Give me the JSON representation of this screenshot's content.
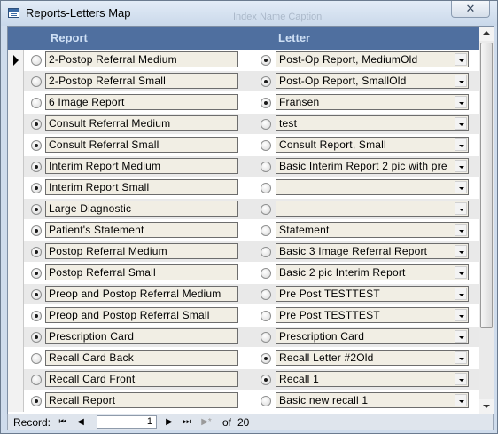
{
  "window": {
    "title": "Reports-Letters Map",
    "ghost_title": "Index Name Caption",
    "close_label": "✕"
  },
  "columns": {
    "report": "Report",
    "letter": "Letter"
  },
  "rows": [
    {
      "report": "2-Postop Referral Medium",
      "report_selected": false,
      "letter": "Post-Op Report, MediumOld",
      "letter_selected": true,
      "current": true
    },
    {
      "report": "2-Postop Referral Small",
      "report_selected": false,
      "letter": "Post-Op Report, SmallOld",
      "letter_selected": true,
      "current": false
    },
    {
      "report": "6 Image Report",
      "report_selected": false,
      "letter": "Fransen",
      "letter_selected": true,
      "current": false
    },
    {
      "report": "Consult Referral Medium",
      "report_selected": true,
      "letter": "test",
      "letter_selected": false,
      "current": false
    },
    {
      "report": "Consult Referral Small",
      "report_selected": true,
      "letter": "Consult Report, Small",
      "letter_selected": false,
      "current": false
    },
    {
      "report": "Interim Report Medium",
      "report_selected": true,
      "letter": "Basic Interim Report 2 pic with pre",
      "letter_selected": false,
      "current": false
    },
    {
      "report": "Interim Report Small",
      "report_selected": true,
      "letter": "",
      "letter_selected": false,
      "current": false
    },
    {
      "report": "Large Diagnostic",
      "report_selected": true,
      "letter": "",
      "letter_selected": false,
      "current": false
    },
    {
      "report": "Patient's Statement",
      "report_selected": true,
      "letter": "Statement",
      "letter_selected": false,
      "current": false
    },
    {
      "report": "Postop Referral Medium",
      "report_selected": true,
      "letter": "Basic 3 Image Referral Report",
      "letter_selected": false,
      "current": false
    },
    {
      "report": "Postop Referral Small",
      "report_selected": true,
      "letter": "Basic 2 pic Interim Report",
      "letter_selected": false,
      "current": false
    },
    {
      "report": "Preop and Postop Referral Medium",
      "report_selected": true,
      "letter": "Pre Post TESTTEST",
      "letter_selected": false,
      "current": false
    },
    {
      "report": "Preop and Postop Referral Small",
      "report_selected": true,
      "letter": "Pre Post TESTTEST",
      "letter_selected": false,
      "current": false
    },
    {
      "report": "Prescription Card",
      "report_selected": true,
      "letter": "Prescription Card",
      "letter_selected": false,
      "current": false
    },
    {
      "report": "Recall Card Back",
      "report_selected": false,
      "letter": "Recall Letter #2Old",
      "letter_selected": true,
      "current": false
    },
    {
      "report": "Recall Card Front",
      "report_selected": false,
      "letter": "Recall 1",
      "letter_selected": true,
      "current": false
    },
    {
      "report": "Recall Report",
      "report_selected": true,
      "letter": "Basic new recall 1",
      "letter_selected": false,
      "current": false
    }
  ],
  "navigation": {
    "label": "Record:",
    "first": "⏮",
    "prev": "◀",
    "current": "1",
    "next": "▶",
    "last": "⏭",
    "new": "▶*",
    "of_label": "of",
    "total": "20"
  }
}
